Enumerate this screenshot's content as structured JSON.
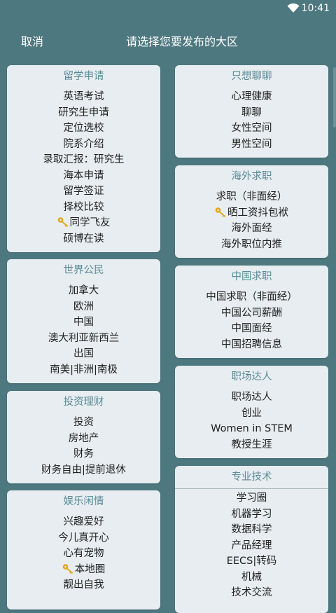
{
  "status": {
    "time": "10:41"
  },
  "header": {
    "cancel": "取消",
    "title": "请选择您要发布的大区"
  },
  "cards": [
    {
      "title": "留学申请",
      "items": [
        {
          "label": "英语考试"
        },
        {
          "label": "研究生申请"
        },
        {
          "label": "定位选校"
        },
        {
          "label": "院系介绍"
        },
        {
          "label": "录取汇报：研究生"
        },
        {
          "label": "海本申请"
        },
        {
          "label": "留学签证"
        },
        {
          "label": "择校比较"
        },
        {
          "label": "同学飞友",
          "key": true
        },
        {
          "label": "硕博在读"
        }
      ]
    },
    {
      "title": "只想聊聊",
      "items": [
        {
          "label": "心理健康"
        },
        {
          "label": "聊聊"
        },
        {
          "label": "女性空间"
        },
        {
          "label": "男性空间"
        }
      ]
    },
    {
      "title": "海外求职",
      "items": [
        {
          "label": "求职（非面经）"
        },
        {
          "label": "晒工资抖包袱",
          "key": true
        },
        {
          "label": "海外面经"
        },
        {
          "label": "海外职位内推"
        }
      ]
    },
    {
      "title": "世界公民",
      "items": [
        {
          "label": "加拿大"
        },
        {
          "label": "欧洲"
        },
        {
          "label": "中国"
        },
        {
          "label": "澳大利亚新西兰"
        },
        {
          "label": "出国"
        },
        {
          "label": "南美|非洲|南极"
        }
      ]
    },
    {
      "title": "中国求职",
      "items": [
        {
          "label": "中国求职（非面经）"
        },
        {
          "label": "中国公司薪酬"
        },
        {
          "label": "中国面经"
        },
        {
          "label": "中国招聘信息"
        }
      ]
    },
    {
      "title": "职场达人",
      "items": [
        {
          "label": "职场达人"
        },
        {
          "label": "创业"
        },
        {
          "label": "Women in STEM"
        },
        {
          "label": "教授生涯"
        }
      ]
    },
    {
      "title": "投资理财",
      "items": [
        {
          "label": "投资"
        },
        {
          "label": "房地产"
        },
        {
          "label": "财务"
        },
        {
          "label": "财务自由|提前退休"
        }
      ]
    },
    {
      "title": "专业技术",
      "items": [
        {
          "label": "学习圈"
        },
        {
          "label": "机器学习"
        },
        {
          "label": "数据科学"
        },
        {
          "label": "产品经理"
        },
        {
          "label": "EECS|转码"
        },
        {
          "label": "机械"
        },
        {
          "label": "技术交流"
        }
      ]
    },
    {
      "title": "娱乐闲情",
      "items": [
        {
          "label": "兴趣爱好"
        },
        {
          "label": "今儿真开心"
        },
        {
          "label": "心有宠物"
        },
        {
          "label": "本地圈",
          "key": true
        },
        {
          "label": "靓出自我"
        }
      ]
    }
  ],
  "icons": {
    "status": "wifi-icon",
    "item_badge": "key-icon"
  },
  "colors": {
    "background": "#4e7880",
    "card": "#e7edf0",
    "card_title": "#5b8b98",
    "key": "#e2a51c"
  }
}
